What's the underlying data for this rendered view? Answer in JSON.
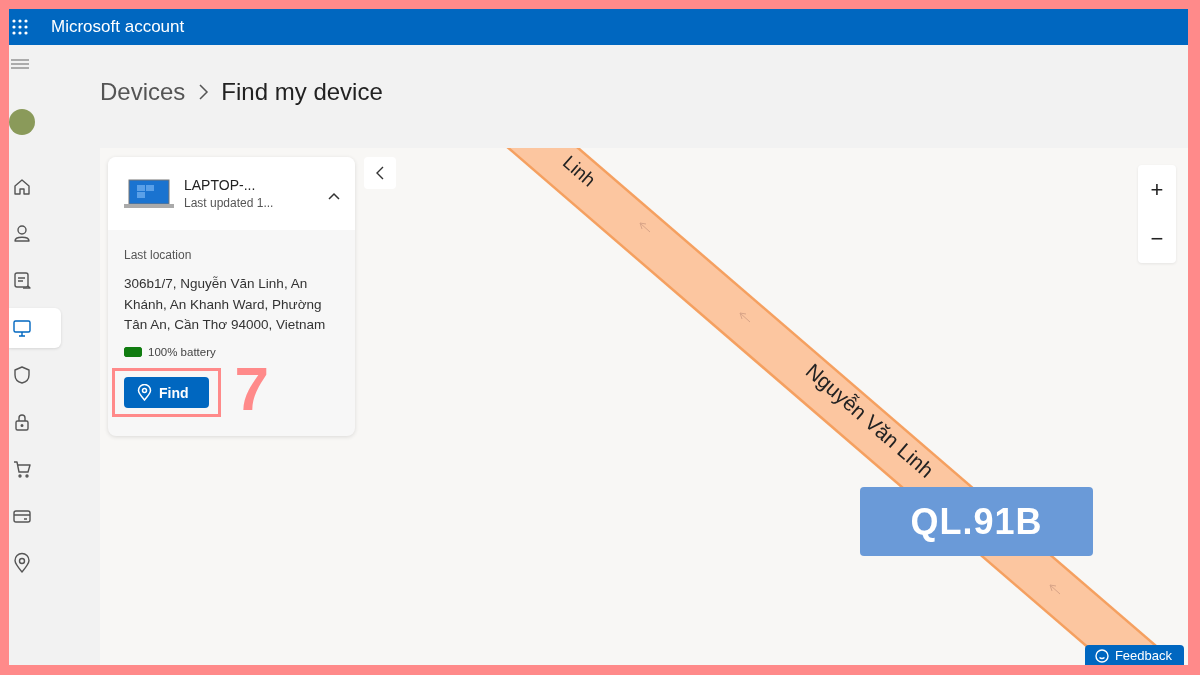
{
  "app_bar": {
    "title": "Microsoft account"
  },
  "nav_rail": {
    "items": [
      {
        "kind": "home",
        "selected": false
      },
      {
        "kind": "person",
        "selected": false
      },
      {
        "kind": "orders",
        "selected": false
      },
      {
        "kind": "devices",
        "selected": true
      },
      {
        "kind": "shield",
        "selected": false
      },
      {
        "kind": "lock",
        "selected": false
      },
      {
        "kind": "cart",
        "selected": false
      },
      {
        "kind": "card",
        "selected": false
      },
      {
        "kind": "location",
        "selected": false
      }
    ]
  },
  "breadcrumb": [
    {
      "label": "Devices",
      "current": false
    },
    {
      "label": "Find my device",
      "current": true
    }
  ],
  "device_card": {
    "name": "LAPTOP-...",
    "updated": "Last updated 1...",
    "expanded": true,
    "location_label": "Last location",
    "address": "306b1/7, Nguyễn Văn Linh, An Khánh, An Khanh Ward, Phường Tân An, Cần Thơ 94000, Vietnam",
    "battery": {
      "level": 1,
      "text": "100% battery"
    },
    "find_button": "Find"
  },
  "map": {
    "road_labels": [
      "Linh",
      "Nguyễn Văn Linh"
    ],
    "route_shield": "QL.91B",
    "zoom_in": "+",
    "zoom_out": "−"
  },
  "feedback_button": "Feedback",
  "annotation": {
    "label": "7"
  }
}
